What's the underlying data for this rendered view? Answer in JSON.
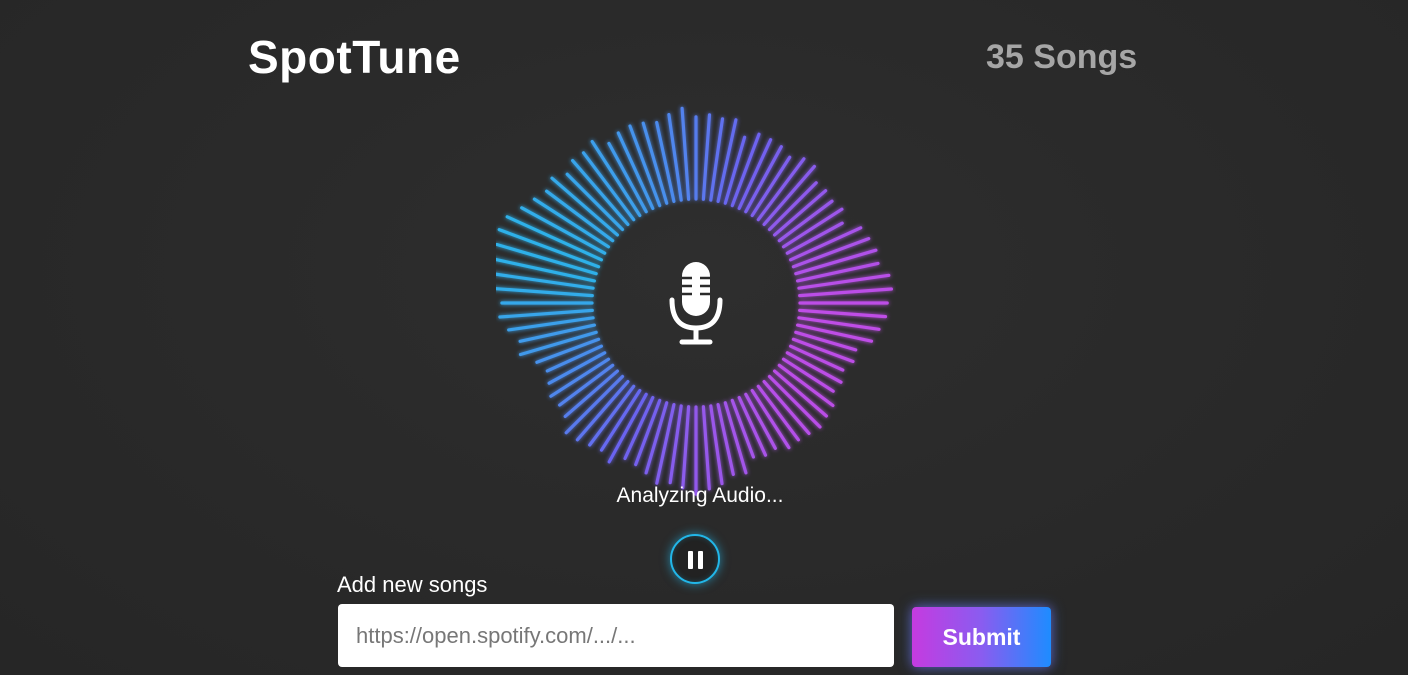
{
  "header": {
    "app_title": "SpotTune",
    "song_count": "35 Songs"
  },
  "player": {
    "status": "Analyzing Audio...",
    "center_icon": "microphone-icon",
    "control_icon": "pause-icon"
  },
  "add_songs": {
    "label": "Add new songs",
    "input_placeholder": "https://open.spotify.com/.../...",
    "input_value": "",
    "submit_label": "Submit"
  },
  "colors": {
    "background": "#2a2a2a",
    "visualizer_start": "#22c0e8",
    "visualizer_mid": "#6a64f0",
    "visualizer_end": "#c94ae6",
    "pause_ring": "#22b6e8",
    "submit_gradient_start": "#c53be0",
    "submit_gradient_end": "#1e8cff"
  }
}
